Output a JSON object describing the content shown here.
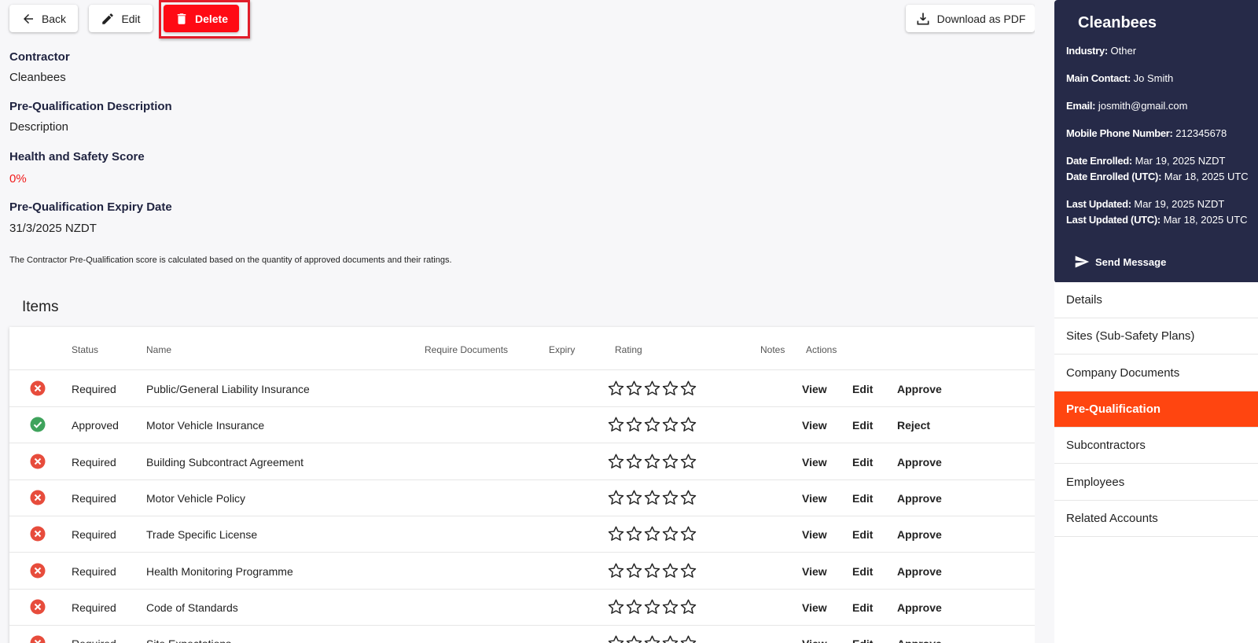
{
  "toolbar": {
    "back_label": "Back",
    "edit_label": "Edit",
    "delete_label": "Delete",
    "download_label": "Download as PDF"
  },
  "details": {
    "contractor_label": "Contractor",
    "contractor_value": "Cleanbees",
    "description_label": "Pre-Qualification Description",
    "description_value": "Description",
    "score_label": "Health and Safety Score",
    "score_value": "0%",
    "expiry_label": "Pre-Qualification Expiry Date",
    "expiry_value": "31/3/2025 NZDT",
    "note": "The Contractor Pre-Qualification score is calculated based on the quantity of approved documents and their ratings."
  },
  "items": {
    "title": "Items",
    "columns": {
      "status": "Status",
      "name": "Name",
      "require_documents": "Require Documents",
      "expiry": "Expiry",
      "rating": "Rating",
      "notes": "Notes",
      "actions": "Actions"
    },
    "action_labels": {
      "view": "View",
      "edit": "Edit"
    },
    "rows": [
      {
        "status": "Required",
        "name": "Public/General Liability Insurance",
        "rating": 0,
        "third_action": "Approve",
        "icon": "error-circle-icon"
      },
      {
        "status": "Approved",
        "name": "Motor Vehicle Insurance",
        "rating": 0,
        "third_action": "Reject",
        "icon": "check-circle-icon"
      },
      {
        "status": "Required",
        "name": "Building Subcontract Agreement",
        "rating": 0,
        "third_action": "Approve",
        "icon": "error-circle-icon"
      },
      {
        "status": "Required",
        "name": "Motor Vehicle Policy",
        "rating": 0,
        "third_action": "Approve",
        "icon": "error-circle-icon"
      },
      {
        "status": "Required",
        "name": "Trade Specific License",
        "rating": 0,
        "third_action": "Approve",
        "icon": "error-circle-icon"
      },
      {
        "status": "Required",
        "name": "Health Monitoring Programme",
        "rating": 0,
        "third_action": "Approve",
        "icon": "error-circle-icon"
      },
      {
        "status": "Required",
        "name": "Code of Standards",
        "rating": 0,
        "third_action": "Approve",
        "icon": "error-circle-icon"
      },
      {
        "status": "Required",
        "name": "Site Expectations",
        "rating": 0,
        "third_action": "Approve",
        "icon": "error-circle-icon"
      }
    ]
  },
  "sidebar": {
    "company_name": "Cleanbees",
    "industry_label": "Industry:",
    "industry_value": "Other",
    "contact_label": "Main Contact:",
    "contact_value": "Jo Smith",
    "email_label": "Email:",
    "email_value": "josmith@gmail.com",
    "phone_label": "Mobile Phone Number:",
    "phone_value": "212345678",
    "enrolled_label": "Date Enrolled:",
    "enrolled_value": "Mar 19, 2025 NZDT",
    "enrolled_utc_label": "Date Enrolled (UTC):",
    "enrolled_utc_value": "Mar 18, 2025 UTC",
    "updated_label": "Last Updated:",
    "updated_value": "Mar 19, 2025 NZDT",
    "updated_utc_label": "Last Updated (UTC):",
    "updated_utc_value": "Mar 18, 2025 UTC",
    "send_message_label": "Send Message",
    "nav": [
      {
        "label": "Details",
        "active": false
      },
      {
        "label": "Sites (Sub-Safety Plans)",
        "active": false
      },
      {
        "label": "Company Documents",
        "active": false
      },
      {
        "label": "Pre-Qualification",
        "active": true
      },
      {
        "label": "Subcontractors",
        "active": false
      },
      {
        "label": "Employees",
        "active": false
      },
      {
        "label": "Related Accounts",
        "active": false
      }
    ]
  },
  "colors": {
    "delete_red": "#ff0a14",
    "sidebar_bg": "#262a48",
    "active_nav": "#ff4510",
    "required_red": "#e74c3c",
    "approved_green": "#3fa35c"
  }
}
